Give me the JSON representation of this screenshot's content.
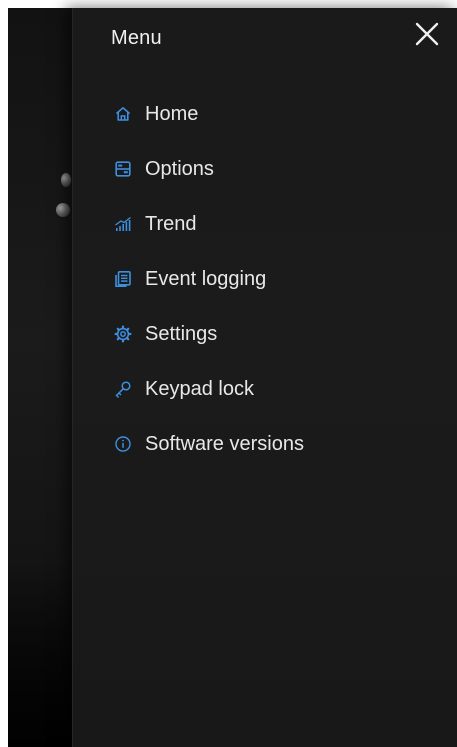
{
  "menu": {
    "title": "Menu",
    "close_icon": "close-icon",
    "accent_color": "#3d8fe0",
    "items": [
      {
        "label": "Home",
        "icon": "home-icon"
      },
      {
        "label": "Options",
        "icon": "options-icon"
      },
      {
        "label": "Trend",
        "icon": "trend-icon"
      },
      {
        "label": "Event logging",
        "icon": "event-log-icon"
      },
      {
        "label": "Settings",
        "icon": "gear-icon"
      },
      {
        "label": "Keypad lock",
        "icon": "key-icon"
      },
      {
        "label": "Software versions",
        "icon": "info-icon"
      }
    ]
  }
}
